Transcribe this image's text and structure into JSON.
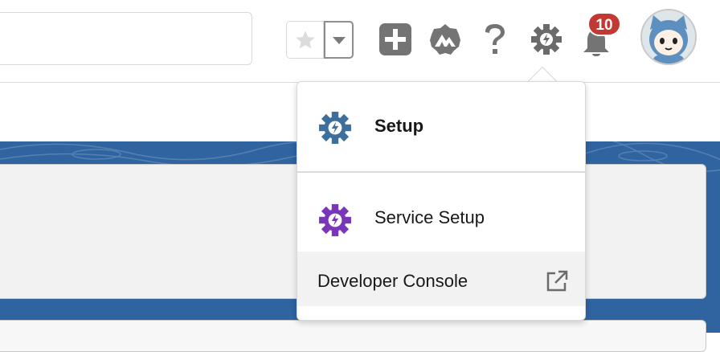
{
  "header": {
    "notification_count": "10",
    "icons": [
      "star-icon",
      "chevron-down-icon",
      "add-icon",
      "trailhead-icon",
      "help-icon",
      "gear-icon",
      "bell-icon",
      "avatar"
    ]
  },
  "setup_menu": {
    "items": [
      {
        "label": "Setup",
        "icon": "setup-gear-icon",
        "color": "#3d6f9c"
      },
      {
        "label": "Service Setup",
        "icon": "service-setup-gear-icon",
        "color": "#7a36b8"
      },
      {
        "label": "Developer Console",
        "icon": "external-link-icon"
      }
    ]
  },
  "colors": {
    "banner": "#2f64a0",
    "badge": "#c23934"
  }
}
